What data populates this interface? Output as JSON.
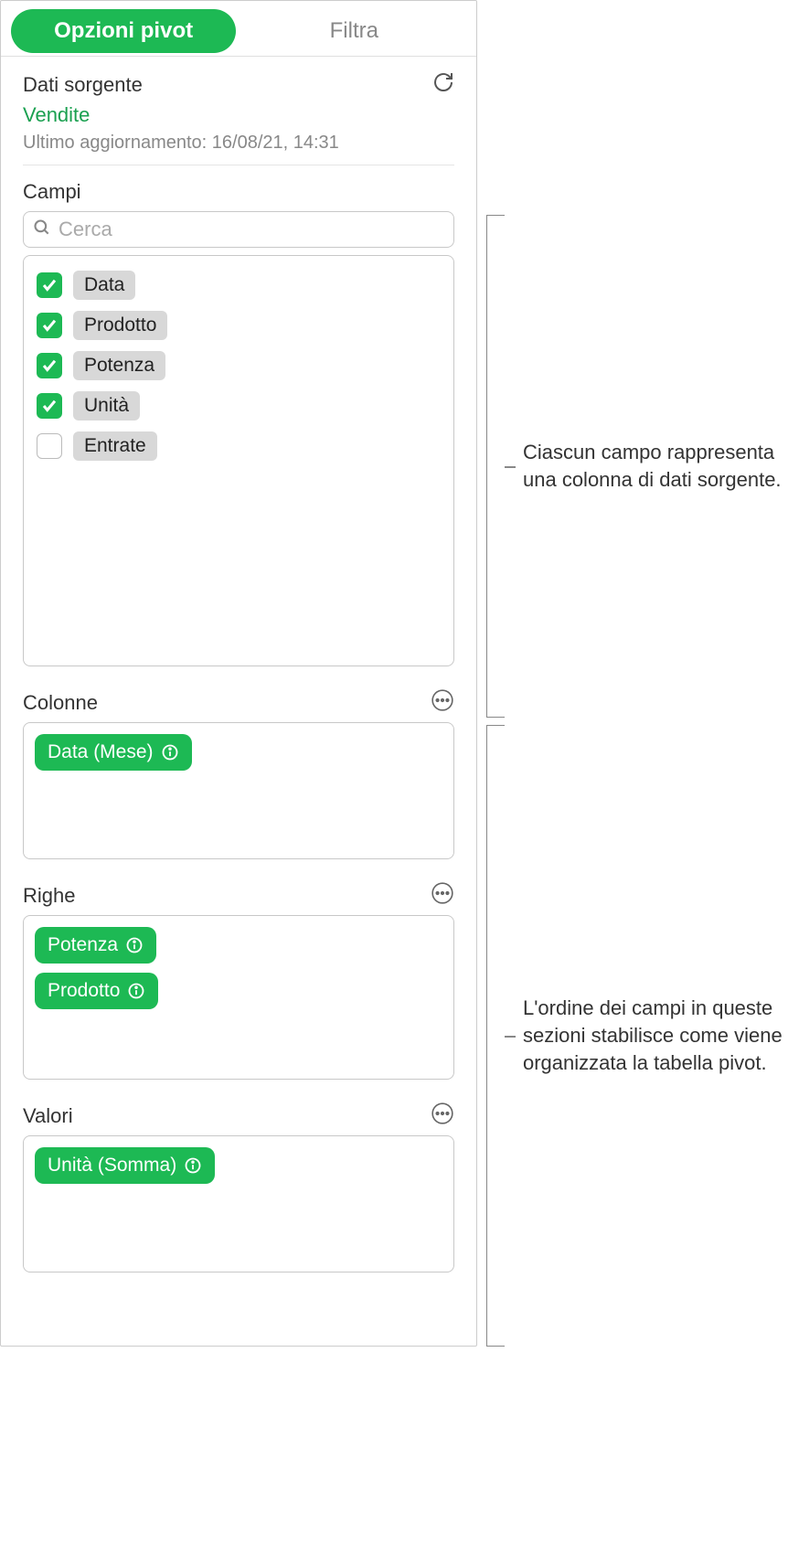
{
  "tabs": {
    "pivot_options": "Opzioni pivot",
    "filter": "Filtra"
  },
  "source": {
    "title": "Dati sorgente",
    "name": "Vendite",
    "updated": "Ultimo aggiornamento: 16/08/21, 14:31"
  },
  "fields": {
    "title": "Campi",
    "search_placeholder": "Cerca",
    "items": [
      {
        "label": "Data",
        "checked": true
      },
      {
        "label": "Prodotto",
        "checked": true
      },
      {
        "label": "Potenza",
        "checked": true
      },
      {
        "label": "Unità",
        "checked": true
      },
      {
        "label": "Entrate",
        "checked": false
      }
    ]
  },
  "zones": {
    "columns": {
      "title": "Colonne",
      "items": [
        "Data (Mese)"
      ]
    },
    "rows": {
      "title": "Righe",
      "items": [
        "Potenza",
        "Prodotto"
      ]
    },
    "values": {
      "title": "Valori",
      "items": [
        "Unità (Somma)"
      ]
    }
  },
  "annotations": {
    "fields_note": "Ciascun campo rappresenta una colonna di dati sorgente.",
    "zones_note": "L'ordine dei campi in queste sezioni stabilisce come viene organizzata la tabella pivot."
  }
}
